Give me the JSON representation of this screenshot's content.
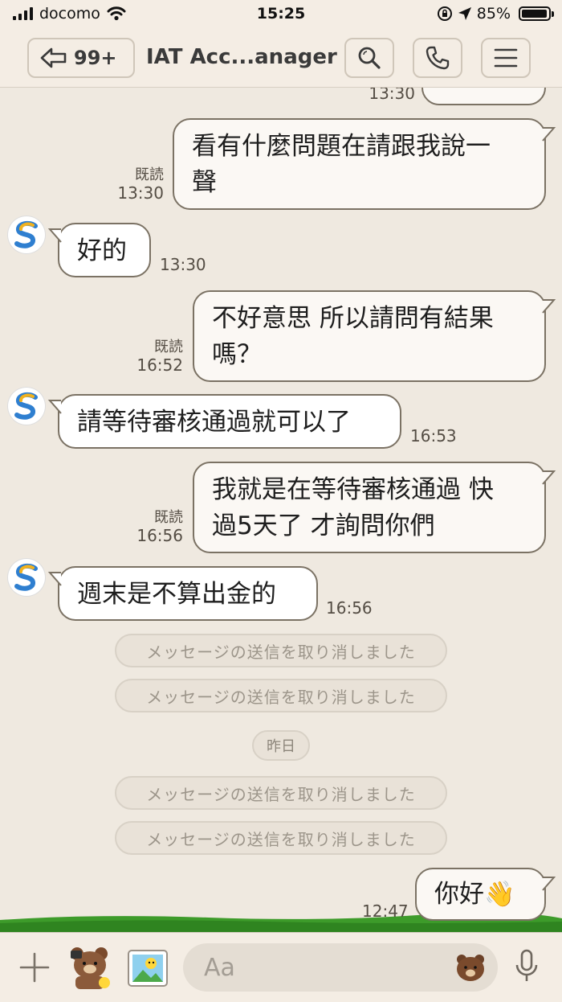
{
  "status_bar": {
    "carrier": "docomo",
    "time": "15:25",
    "battery": "85%",
    "battery_level": 0.85
  },
  "header": {
    "back_count": "99+",
    "title": "IAT Acc...anager"
  },
  "messages": {
    "partial_time": "13:30",
    "m1": {
      "read": "既読",
      "time": "13:30",
      "lines": [
        "看有什麼問題在請跟我說一",
        "聲"
      ]
    },
    "m2": {
      "text": "好的",
      "time": "13:30"
    },
    "m3": {
      "read": "既読",
      "time": "16:52",
      "lines": [
        "不好意思 所以請問有結果",
        "嗎？"
      ]
    },
    "m4": {
      "text": "請等待審核通過就可以了",
      "time": "16:53"
    },
    "m5": {
      "read": "既読",
      "time": "16:56",
      "lines": [
        "我就是在等待審核通過 快",
        "過5天了 才詢問你們"
      ]
    },
    "m6": {
      "text": "週末是不算出金的",
      "time": "16:56"
    },
    "unsent_1": "メッセージの送信を取り消しました",
    "unsent_2": "メッセージの送信を取り消しました",
    "date_divider": "昨日",
    "unsent_3": "メッセージの送信を取り消しました",
    "unsent_4": "メッセージの送信を取り消しました",
    "m7": {
      "text": "你好",
      "emoji": "👋",
      "time": "12:47"
    }
  },
  "input": {
    "placeholder": "Aa"
  },
  "colors": {
    "background": "#efe9e0",
    "bubble_border": "#7b7264",
    "grass": "#3d9b2a"
  },
  "icons": [
    "signal-icon",
    "wifi-icon",
    "rotation-lock-icon",
    "location-arrow-icon",
    "battery-icon",
    "back-arrow-icon",
    "search-icon",
    "phone-icon",
    "menu-icon",
    "plus-icon",
    "sticker-icon",
    "photo-icon",
    "emoji-icon",
    "microphone-icon"
  ]
}
